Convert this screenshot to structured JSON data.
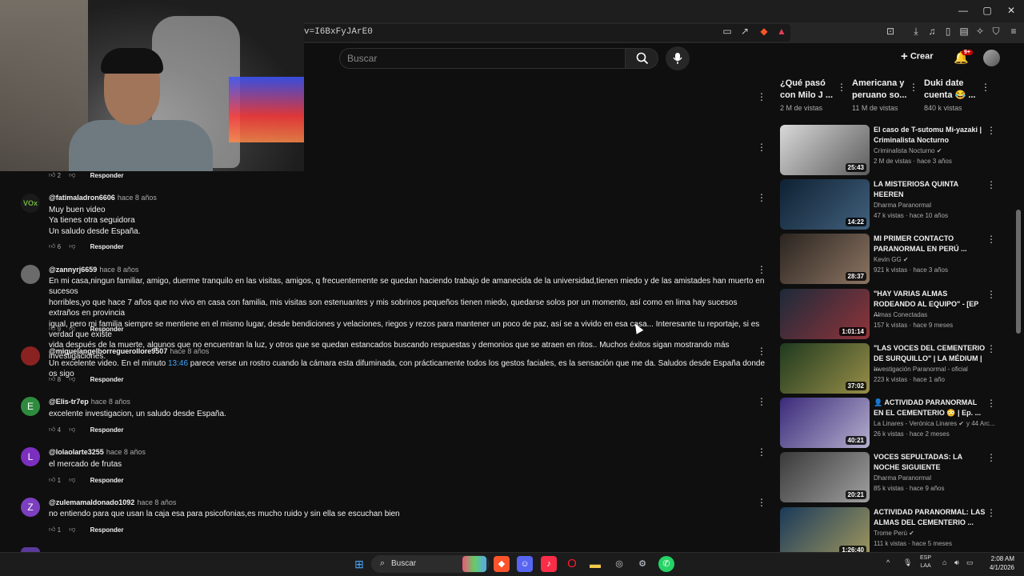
{
  "browser": {
    "url": "v=I6BxFyJArE0",
    "window_controls": [
      "—",
      "▢",
      "✕"
    ]
  },
  "header": {
    "search_placeholder": "Buscar",
    "create_label": "Crear",
    "notifications_badge": "9+"
  },
  "comments": [
    {
      "author": "",
      "time": "",
      "text": [],
      "likes": "2",
      "reply_label": "Responder",
      "avatar_letter": "",
      "avatar_color": "#444444"
    },
    {
      "author": "@fatimaladron6606",
      "time": "hace 8 años",
      "text": [
        "Muy buen video",
        "Ya tienes otra seguidora",
        "Un saludo desde España."
      ],
      "likes": "6",
      "reply_label": "Responder",
      "avatar_letter": "VOx",
      "avatar_color": "#1a1a1a"
    },
    {
      "author": "@zannyrj6659",
      "time": "hace 8 años",
      "text": [
        "En mi casa,ningun familiar, amigo, duerme tranquilo en las visitas,  amigos, q frecuentemente se quedan haciendo trabajo de amanecida de la universidad,tienen miedo y de las amistades han muerto en sucesos",
        "horribles,yo que hace 7 años que no vivo en casa con familia, mis visitas son estenuantes y mis sobrinos pequeños tienen miedo, quedarse solos por un momento, así como en lima hay sucesos extraños en provincia",
        "igual, pero mi familia siempre se mentiene en el mismo lugar, desde bendiciones y velaciones, riegos y rezos para mantener un poco de paz, así se a vivido en esa casa... Interesante tu reportaje, si es verdad que existe",
        "vida después de la muerte, algunos que no encuentran la luz, y otros que se quedan estancados buscando respuestas y demonios que se atraen en ritos.. Muchos éxitos sigan mostrando más investigaciones."
      ],
      "likes": "9",
      "reply_label": "Responder",
      "avatar_letter": "",
      "avatar_color": "#6b6b6b"
    },
    {
      "author": "@miguelangelborreguerollore9507",
      "time": "hace 8 años",
      "text_before": "Un excelente video. En el minuto ",
      "timestamp_link": "13:46",
      "text_after": " parece verse un rostro cuando la cámara esta difuminada, con prácticamente todos los gestos faciales, es la sensación que me da. Saludos desde España donde os sigo",
      "likes": "8",
      "reply_label": "Responder",
      "avatar_letter": "",
      "avatar_color": "#8a2222"
    },
    {
      "author": "@Elis-tr7ep",
      "time": "hace 8 años",
      "text": [
        "excelente investigacion, un saludo desde España."
      ],
      "likes": "4",
      "reply_label": "Responder",
      "avatar_letter": "E",
      "avatar_color": "#2e8b3e"
    },
    {
      "author": "@lolaolarte3255",
      "time": "hace 8 años",
      "text": [
        "el mercado de frutas"
      ],
      "likes": "1",
      "reply_label": "Responder",
      "avatar_letter": "L",
      "avatar_color": "#7b2fbf"
    },
    {
      "author": "@zulemamaldonado1092",
      "time": "hace 8 años",
      "text": [
        "no entiendo para que usan la caja esa para psicofonias,es mucho ruido y sin ella se escuchan bien"
      ],
      "likes": "1",
      "reply_label": "Responder",
      "avatar_letter": "Z",
      "avatar_color": "#7b3fbf"
    }
  ],
  "shorts": [
    {
      "title": "¿Qué pasó con Milo J ...",
      "views": "2 M de vistas"
    },
    {
      "title": "Americana y peruano so...",
      "views": "11 M de vistas"
    },
    {
      "title": "Duki date cuenta 😂 ...",
      "views": "840 k vistas"
    }
  ],
  "sidebar": [
    {
      "title": "El caso de T-sutomu Mi-yazaki | Criminalista Nocturno",
      "channel": "Criminalista Nocturno",
      "verified": true,
      "meta": "2 M de vistas · hace 3 años",
      "duration": "25:43",
      "thumb_bg": "#d9d9d9",
      "thumb_fg": "#111111"
    },
    {
      "title": "LA MISTERIOSA QUINTA HEEREN",
      "channel": "Dharma Paranormal",
      "verified": false,
      "meta": "47 k vistas · hace 10 años",
      "duration": "14:22",
      "thumb_bg": "#0f2133",
      "thumb_fg": "#5f86a8"
    },
    {
      "title": "MI PRIMER CONTACTO PARANORMAL EN PERÚ ...",
      "channel": "Kevin GG",
      "verified": true,
      "meta": "921 k vistas · hace 3 años",
      "duration": "28:37",
      "thumb_bg": "#2a2420",
      "thumb_fg": "#c7a58a"
    },
    {
      "title": "\"HAY VARIAS ALMAS RODEANDO AL EQUIPO\" - [EP ...",
      "channel": "Almas Conectadas",
      "verified": false,
      "meta": "157 k vistas · hace 9 meses",
      "duration": "1:01:14",
      "thumb_bg": "#1d2a3a",
      "thumb_fg": "#d53a3a"
    },
    {
      "title": "\"LAS VOCES DEL CEMENTERIO DE SURQUILLO\" | LA MÉDIUM | ...",
      "channel": "Investigación Paranormal - oficial",
      "verified": false,
      "meta": "223 k vistas · hace 1 año",
      "duration": "37:02",
      "thumb_bg": "#1f3a1f",
      "thumb_fg": "#e0c060"
    },
    {
      "title": "👤 ACTIVIDAD PARANORMAL EN EL CEMENTERIO 😳 | Ep. ...",
      "channel": "La Linares - Verónica Linares",
      "verified": true,
      "meta": "26 k vistas · hace 2 meses",
      "extra": "y 44 Arc...",
      "duration": "40:21",
      "thumb_bg": "#3a2a7a",
      "thumb_fg": "#ffffff"
    },
    {
      "title": "VOCES SEPULTADAS: LA NOCHE SIGUIENTE",
      "channel": "Dharma Paranormal",
      "verified": false,
      "meta": "85 k vistas · hace 9 años",
      "duration": "20:21",
      "thumb_bg": "#3a3a3a",
      "thumb_fg": "#dddddd"
    },
    {
      "title": "ACTIVIDAD PARANORMAL: LAS ALMAS DEL CEMENTERIO ...",
      "channel": "Trome Perú",
      "verified": true,
      "meta": "111 k vistas · hace 5 meses",
      "duration": "1:26:40",
      "thumb_bg": "#1a3a5a",
      "thumb_fg": "#f0d060"
    }
  ],
  "taskbar": {
    "search_label": "Buscar",
    "lang_top": "ESP",
    "lang_bottom": "LAA",
    "time": "2:08 AM",
    "date": "4/1/2026"
  }
}
